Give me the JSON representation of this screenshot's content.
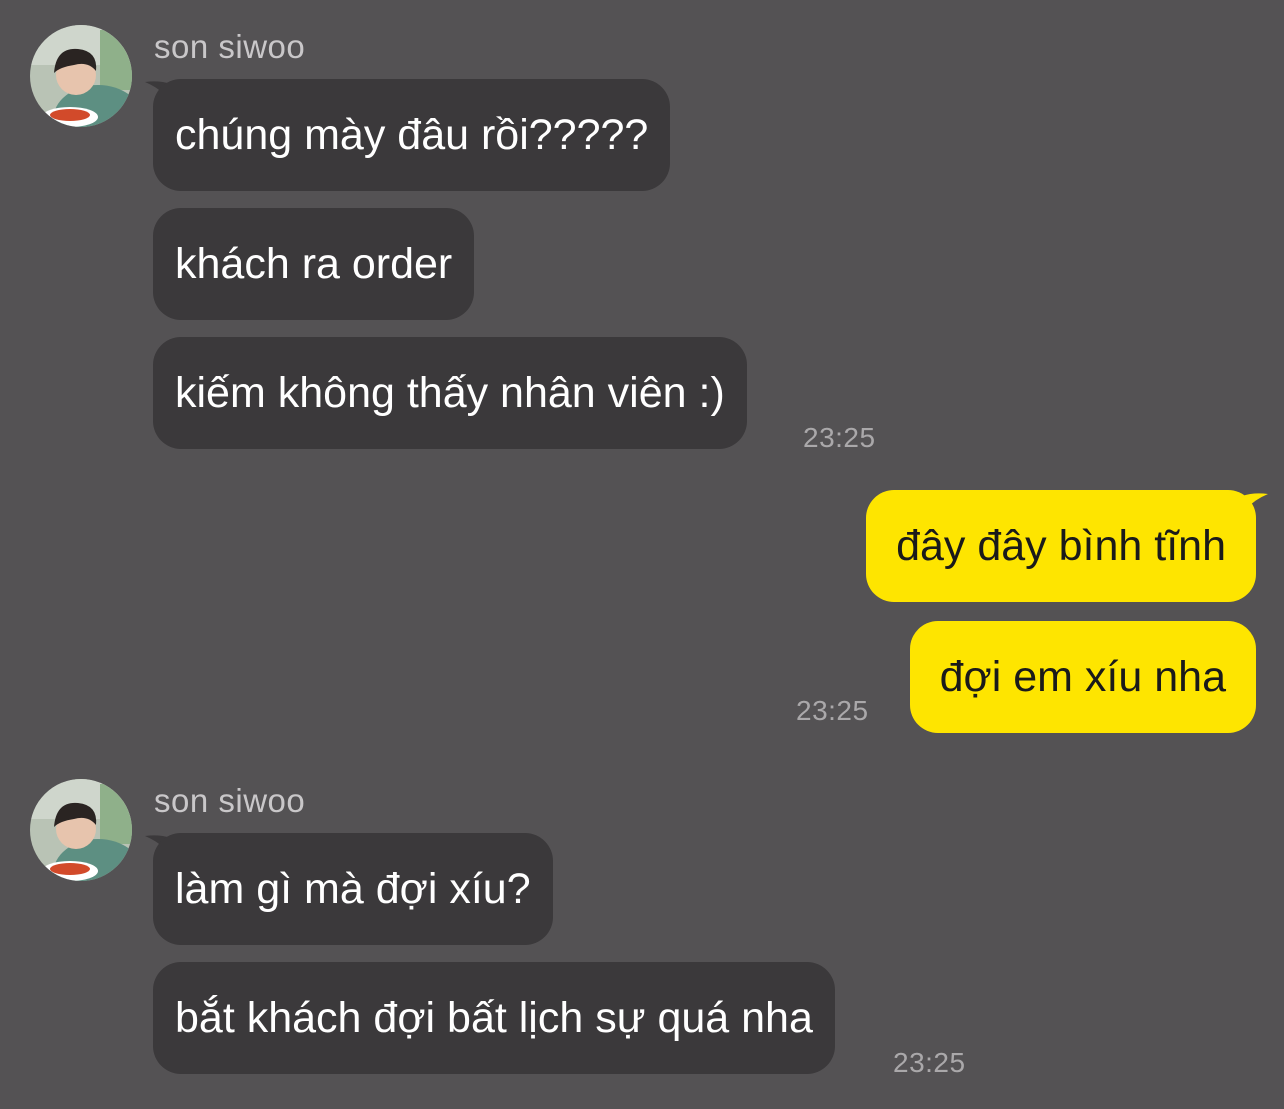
{
  "colors": {
    "background": "#545254",
    "incoming_bubble": "#3b393b",
    "outgoing_bubble": "#fee500",
    "name_text": "#c9c7c9",
    "time_text": "#aaa8aa"
  },
  "groups": [
    {
      "direction": "incoming",
      "sender": "son siwoo",
      "avatar": "profile-photo",
      "messages": [
        "chúng mày đâu rồi?????",
        "khách ra order",
        "kiếm không thấy nhân viên :)"
      ],
      "time": "23:25"
    },
    {
      "direction": "outgoing",
      "messages": [
        "đây đây bình tĩnh",
        "đợi em xíu nha"
      ],
      "time": "23:25"
    },
    {
      "direction": "incoming",
      "sender": "son siwoo",
      "avatar": "profile-photo",
      "messages": [
        "làm gì mà đợi xíu?",
        "bắt khách đợi bất lịch sự quá nha"
      ],
      "time": "23:25"
    }
  ]
}
